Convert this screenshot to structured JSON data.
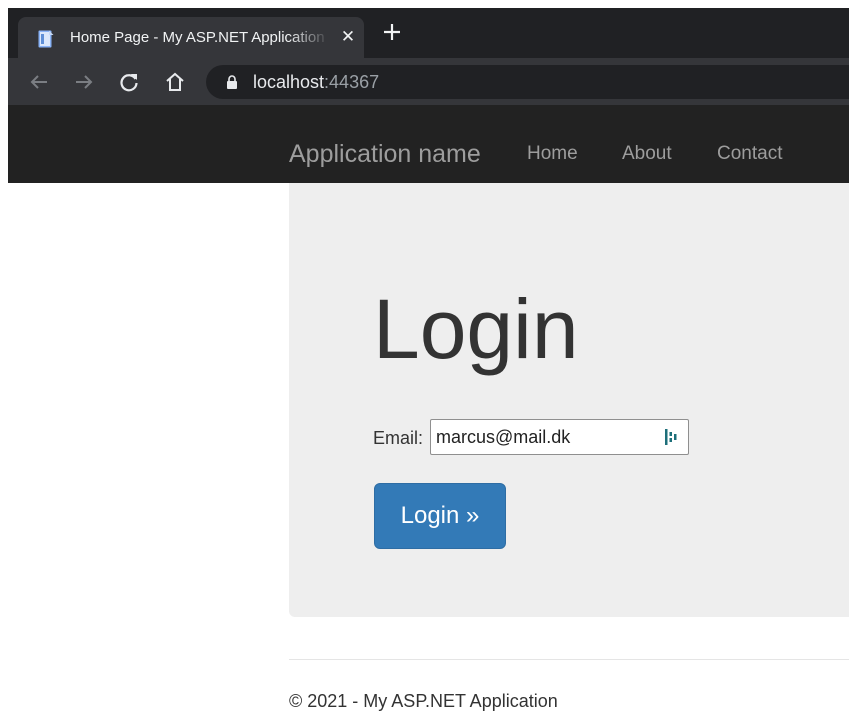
{
  "browser": {
    "tab": {
      "title": "Home Page - My ASP.NET Application",
      "close_label": "✕"
    },
    "address": {
      "host": "localhost",
      "port": ":44367"
    },
    "icons": {
      "favicon": "document-icon",
      "new_tab": "plus-icon",
      "back": "arrow-left-icon",
      "forward": "arrow-right-icon",
      "reload": "reload-icon",
      "home": "home-icon",
      "lock": "lock-icon"
    },
    "colors": {
      "tabstrip": "#202124",
      "toolbar": "#35363a",
      "omnibox": "#202124"
    }
  },
  "navbar": {
    "brand": "Application name",
    "links": [
      "Home",
      "About",
      "Contact"
    ],
    "background": "#222222"
  },
  "main": {
    "heading": "Login",
    "email_label": "Email:",
    "email_value": "marcus@mail.dk",
    "login_button": "Login »",
    "field_icon": "password-manager-icon",
    "colors": {
      "panel": "#eeeeee",
      "button": "#337ab7"
    }
  },
  "footer": {
    "text": "© 2021 - My ASP.NET Application"
  }
}
